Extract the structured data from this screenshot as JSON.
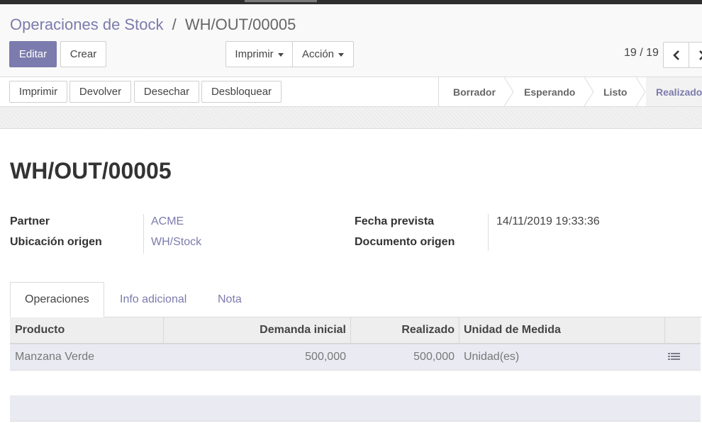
{
  "breadcrumb": {
    "parent": "Operaciones de Stock",
    "separator": "/",
    "current": "WH/OUT/00005"
  },
  "toolbar": {
    "edit_label": "Editar",
    "create_label": "Crear",
    "print_label": "Imprimir",
    "action_label": "Acción"
  },
  "pager": {
    "value": "19 / 19"
  },
  "statusbar": {
    "buttons": [
      "Imprimir",
      "Devolver",
      "Desechar",
      "Desbloquear"
    ],
    "stages": [
      "Borrador",
      "Esperando",
      "Listo",
      "Realizado"
    ],
    "active_stage": "Realizado"
  },
  "form": {
    "title": "WH/OUT/00005",
    "partner_label": "Partner",
    "partner_value": "ACME",
    "location_label": "Ubicación origen",
    "location_value": "WH/Stock",
    "date_label": "Fecha prevista",
    "date_value": "14/11/2019 19:33:36",
    "origin_label": "Documento origen",
    "origin_value": ""
  },
  "tabs": [
    "Operaciones",
    "Info adicional",
    "Nota"
  ],
  "table": {
    "columns": [
      "Producto",
      "Demanda inicial",
      "Realizado",
      "Unidad de Medida"
    ],
    "rows": [
      {
        "product": "Manzana Verde",
        "demand": "500,000",
        "done": "500,000",
        "uom": "Unidad(es)"
      }
    ]
  },
  "colors": {
    "brand": "#7c7bad",
    "row_highlight": "#eaeaf3"
  }
}
